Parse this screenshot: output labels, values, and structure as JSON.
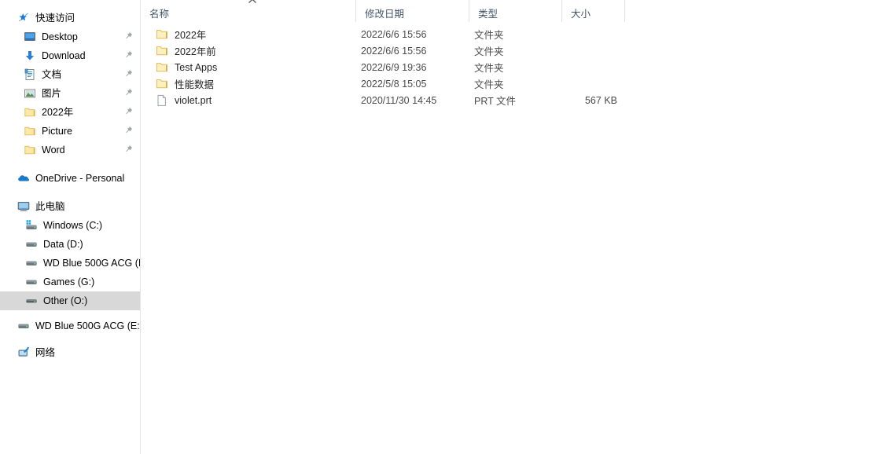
{
  "window": {
    "type": "file-explorer",
    "selection_color": "#d8d8d8",
    "header_text_color": "#44546a"
  },
  "nav_pane": {
    "groups": [
      {
        "name": "quick-access",
        "root": {
          "label": "快速访问",
          "icon": "star-pin-icon",
          "expanded": true
        },
        "items": [
          {
            "label": "Desktop",
            "icon": "desktop-icon",
            "pinned": true
          },
          {
            "label": "Download",
            "icon": "download-icon",
            "pinned": true
          },
          {
            "label": "文档",
            "icon": "documents-icon",
            "pinned": true
          },
          {
            "label": "图片",
            "icon": "pictures-icon",
            "pinned": true
          },
          {
            "label": "2022年",
            "icon": "folder-icon",
            "pinned": true
          },
          {
            "label": "Picture",
            "icon": "folder-icon",
            "pinned": true
          },
          {
            "label": "Word",
            "icon": "folder-icon",
            "pinned": true
          }
        ]
      },
      {
        "name": "onedrive",
        "root": {
          "label": "OneDrive - Personal",
          "icon": "cloud-icon",
          "expanded": false
        },
        "items": []
      },
      {
        "name": "this-pc",
        "root": {
          "label": "此电脑",
          "icon": "this-pc-icon",
          "expanded": true
        },
        "items": [
          {
            "label": "Windows (C:)",
            "icon": "windows-drive-icon",
            "selected": false
          },
          {
            "label": "Data (D:)",
            "icon": "drive-icon",
            "selected": false
          },
          {
            "label": "WD Blue 500G ACG (I",
            "icon": "drive-icon",
            "selected": false
          },
          {
            "label": "Games (G:)",
            "icon": "drive-icon",
            "selected": false
          },
          {
            "label": "Other (O:)",
            "icon": "drive-icon",
            "selected": true
          }
        ]
      },
      {
        "name": "external-drive",
        "root": {
          "label": "WD Blue 500G ACG (E:",
          "icon": "drive-icon",
          "expanded": false
        },
        "items": []
      },
      {
        "name": "network",
        "root": {
          "label": "网络",
          "icon": "network-icon",
          "expanded": false
        },
        "items": []
      }
    ]
  },
  "file_list": {
    "columns": [
      {
        "key": "name",
        "label": "名称",
        "sorted": true,
        "sort_direction": "ascending"
      },
      {
        "key": "date",
        "label": "修改日期",
        "sorted": false
      },
      {
        "key": "type",
        "label": "类型",
        "sorted": false
      },
      {
        "key": "size",
        "label": "大小",
        "sorted": false
      }
    ],
    "rows": [
      {
        "name": "2022年",
        "icon": "folder-icon",
        "date": "2022/6/6 15:56",
        "type": "文件夹",
        "size": ""
      },
      {
        "name": "2022年前",
        "icon": "folder-icon",
        "date": "2022/6/6 15:56",
        "type": "文件夹",
        "size": ""
      },
      {
        "name": "Test Apps",
        "icon": "folder-icon",
        "date": "2022/6/9 19:36",
        "type": "文件夹",
        "size": ""
      },
      {
        "name": "性能数据",
        "icon": "folder-icon",
        "date": "2022/5/8 15:05",
        "type": "文件夹",
        "size": ""
      },
      {
        "name": "violet.prt",
        "icon": "file-icon",
        "date": "2020/11/30 14:45",
        "type": "PRT 文件",
        "size": "567 KB"
      }
    ]
  }
}
